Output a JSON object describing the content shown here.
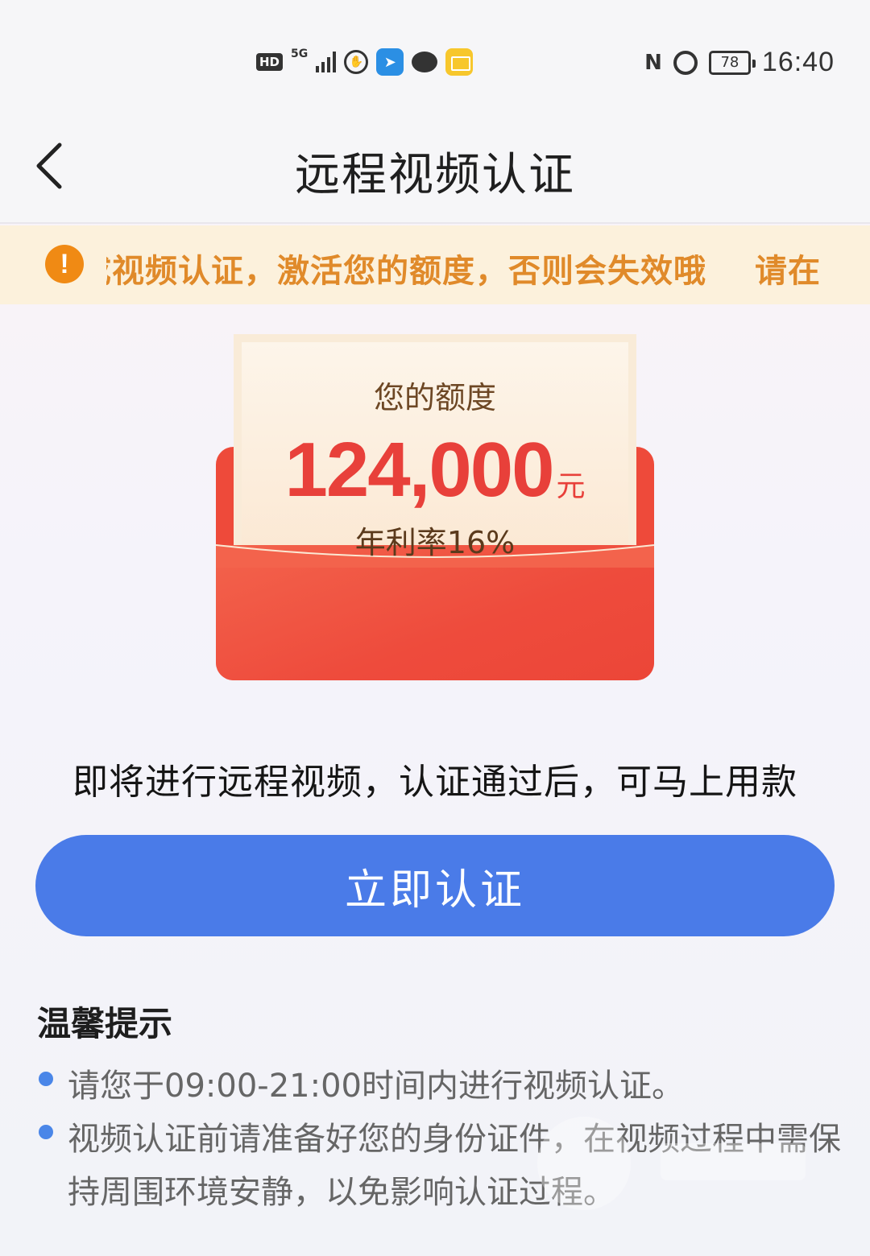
{
  "status_bar": {
    "hd": "HD",
    "network": "5G",
    "battery": "78",
    "time": "16:40",
    "icons": [
      "hd-icon",
      "signal-5g-icon",
      "vpn-icon",
      "app-icon",
      "chat-icon",
      "mail-icon",
      "nfc-icon",
      "alarm-icon",
      "battery-icon"
    ]
  },
  "header": {
    "title": "远程视频认证",
    "back_icon": "chevron-left-icon"
  },
  "notice": {
    "icon": "warning-icon",
    "text": "成视频认证，激活您的额度，否则会失效哦",
    "text_next": "请在"
  },
  "limit_card": {
    "label": "您的额度",
    "amount": "124,000",
    "unit": "元",
    "rate": "年利率16%"
  },
  "info": "即将进行远程视频，认证通过后，可马上用款",
  "primary_button": "立即认证",
  "tips": {
    "title": "温馨提示",
    "items": [
      "请您于09:00-21:00时间内进行视频认证。",
      "视频认证前请准备好您的身份证件，在视频过程中需保持周围环境安静，以免影响认证过程。"
    ]
  },
  "colors": {
    "accent": "#4a7be8",
    "envelope_red": "#ee4a3a",
    "amount_red": "#e8403a",
    "notice_bg": "#fcf1dc",
    "notice_text": "#e08a2a",
    "warning_icon": "#f08a14"
  }
}
